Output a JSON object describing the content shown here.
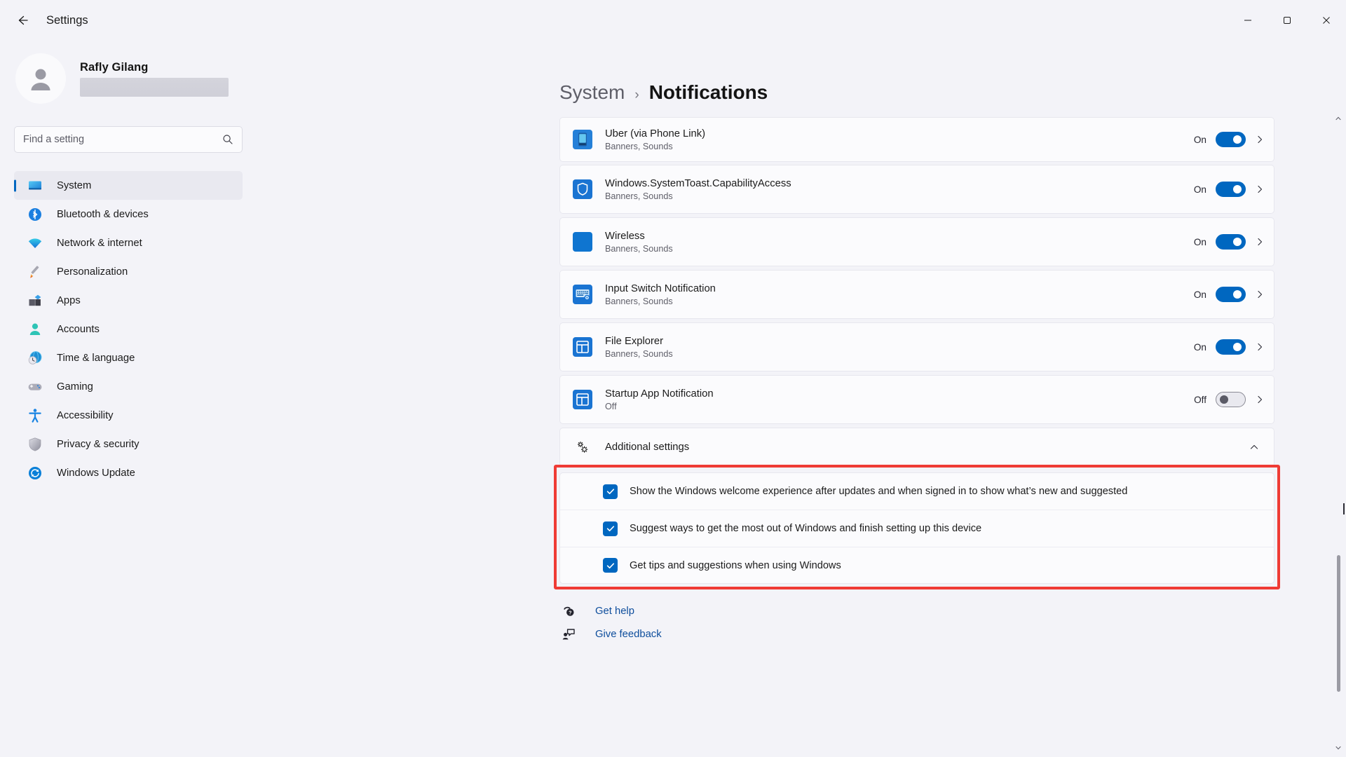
{
  "window": {
    "title": "Settings",
    "back_icon": "back-arrow-icon",
    "minimize_label": "Minimize",
    "maximize_label": "Restore",
    "close_label": "Close"
  },
  "sidebar": {
    "profile": {
      "name": "Rafly Gilang",
      "email_redacted": ""
    },
    "search": {
      "placeholder": "Find a setting",
      "value": "",
      "icon": "search-icon"
    },
    "items": [
      {
        "label": "System",
        "icon": "system-icon",
        "selected": true
      },
      {
        "label": "Bluetooth & devices",
        "icon": "bluetooth-icon",
        "selected": false
      },
      {
        "label": "Network & internet",
        "icon": "network-icon",
        "selected": false
      },
      {
        "label": "Personalization",
        "icon": "paintbrush-icon",
        "selected": false
      },
      {
        "label": "Apps",
        "icon": "apps-icon",
        "selected": false
      },
      {
        "label": "Accounts",
        "icon": "accounts-icon",
        "selected": false
      },
      {
        "label": "Time & language",
        "icon": "clock-globe-icon",
        "selected": false
      },
      {
        "label": "Gaming",
        "icon": "gamepad-icon",
        "selected": false
      },
      {
        "label": "Accessibility",
        "icon": "accessibility-icon",
        "selected": false
      },
      {
        "label": "Privacy & security",
        "icon": "shield-icon",
        "selected": false
      },
      {
        "label": "Windows Update",
        "icon": "update-icon",
        "selected": false
      }
    ]
  },
  "main": {
    "breadcrumb": {
      "parent": "System",
      "separator": "›",
      "current": "Notifications"
    },
    "app_rows": [
      {
        "title": "Uber (via Phone Link)",
        "subtitle": "Banners, Sounds",
        "state": "On",
        "toggle_on": true,
        "icon": "phone-app-icon"
      },
      {
        "title": "Windows.SystemToast.CapabilityAccess",
        "subtitle": "Banners, Sounds",
        "state": "On",
        "toggle_on": true,
        "icon": "shield-app-icon"
      },
      {
        "title": "Wireless",
        "subtitle": "Banners, Sounds",
        "state": "On",
        "toggle_on": true,
        "icon": "blue-square-icon"
      },
      {
        "title": "Input Switch Notification",
        "subtitle": "Banners, Sounds",
        "state": "On",
        "toggle_on": true,
        "icon": "keyboard-icon"
      },
      {
        "title": "File Explorer",
        "subtitle": "Banners, Sounds",
        "state": "On",
        "toggle_on": true,
        "icon": "file-explorer-icon"
      },
      {
        "title": "Startup App Notification",
        "subtitle": "Off",
        "state": "Off",
        "toggle_on": false,
        "icon": "file-explorer-icon"
      }
    ],
    "additional_settings": {
      "label": "Additional settings",
      "icon": "gears-icon",
      "expanded": true,
      "chevron": "chevron-up-icon",
      "checkboxes": [
        {
          "label": "Show the Windows welcome experience after updates and when signed in to show what’s new and suggested",
          "checked": true
        },
        {
          "label": "Suggest ways to get the most out of Windows and finish setting up this device",
          "checked": true
        },
        {
          "label": "Get tips and suggestions when using Windows",
          "checked": true
        }
      ]
    },
    "footer_links": [
      {
        "label": "Get help",
        "icon": "get-help-icon"
      },
      {
        "label": "Give feedback",
        "icon": "give-feedback-icon"
      }
    ]
  },
  "colors": {
    "accent": "#0067c0",
    "link": "#0d4d9c",
    "annotation": "#ef3b35",
    "page_bg": "#f3f3f8",
    "card_bg": "#fbfbfd"
  }
}
